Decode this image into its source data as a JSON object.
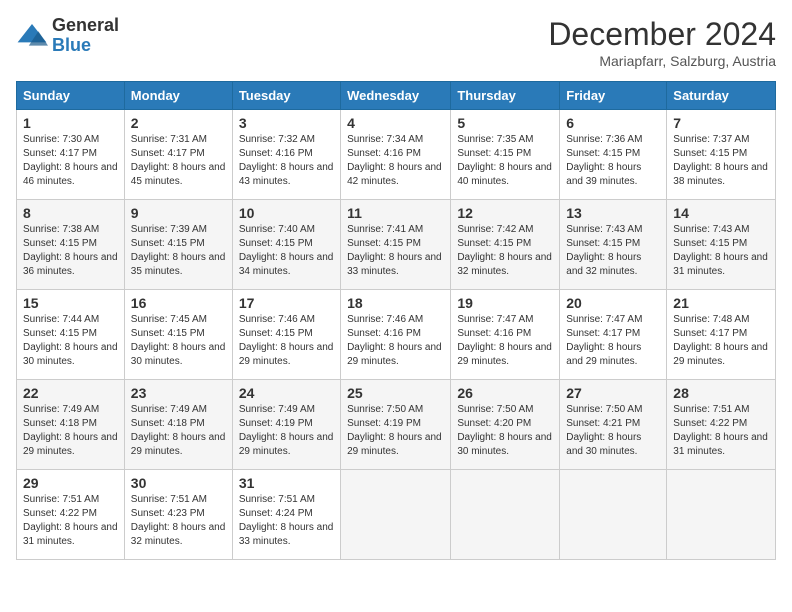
{
  "logo": {
    "general": "General",
    "blue": "Blue"
  },
  "title": {
    "month_year": "December 2024",
    "location": "Mariapfarr, Salzburg, Austria"
  },
  "weekdays": [
    "Sunday",
    "Monday",
    "Tuesday",
    "Wednesday",
    "Thursday",
    "Friday",
    "Saturday"
  ],
  "weeks": [
    [
      {
        "day": "1",
        "sunrise": "7:30 AM",
        "sunset": "4:17 PM",
        "daylight": "8 hours and 46 minutes."
      },
      {
        "day": "2",
        "sunrise": "7:31 AM",
        "sunset": "4:17 PM",
        "daylight": "8 hours and 45 minutes."
      },
      {
        "day": "3",
        "sunrise": "7:32 AM",
        "sunset": "4:16 PM",
        "daylight": "8 hours and 43 minutes."
      },
      {
        "day": "4",
        "sunrise": "7:34 AM",
        "sunset": "4:16 PM",
        "daylight": "8 hours and 42 minutes."
      },
      {
        "day": "5",
        "sunrise": "7:35 AM",
        "sunset": "4:15 PM",
        "daylight": "8 hours and 40 minutes."
      },
      {
        "day": "6",
        "sunrise": "7:36 AM",
        "sunset": "4:15 PM",
        "daylight": "8 hours and 39 minutes."
      },
      {
        "day": "7",
        "sunrise": "7:37 AM",
        "sunset": "4:15 PM",
        "daylight": "8 hours and 38 minutes."
      }
    ],
    [
      {
        "day": "8",
        "sunrise": "7:38 AM",
        "sunset": "4:15 PM",
        "daylight": "8 hours and 36 minutes."
      },
      {
        "day": "9",
        "sunrise": "7:39 AM",
        "sunset": "4:15 PM",
        "daylight": "8 hours and 35 minutes."
      },
      {
        "day": "10",
        "sunrise": "7:40 AM",
        "sunset": "4:15 PM",
        "daylight": "8 hours and 34 minutes."
      },
      {
        "day": "11",
        "sunrise": "7:41 AM",
        "sunset": "4:15 PM",
        "daylight": "8 hours and 33 minutes."
      },
      {
        "day": "12",
        "sunrise": "7:42 AM",
        "sunset": "4:15 PM",
        "daylight": "8 hours and 32 minutes."
      },
      {
        "day": "13",
        "sunrise": "7:43 AM",
        "sunset": "4:15 PM",
        "daylight": "8 hours and 32 minutes."
      },
      {
        "day": "14",
        "sunrise": "7:43 AM",
        "sunset": "4:15 PM",
        "daylight": "8 hours and 31 minutes."
      }
    ],
    [
      {
        "day": "15",
        "sunrise": "7:44 AM",
        "sunset": "4:15 PM",
        "daylight": "8 hours and 30 minutes."
      },
      {
        "day": "16",
        "sunrise": "7:45 AM",
        "sunset": "4:15 PM",
        "daylight": "8 hours and 30 minutes."
      },
      {
        "day": "17",
        "sunrise": "7:46 AM",
        "sunset": "4:15 PM",
        "daylight": "8 hours and 29 minutes."
      },
      {
        "day": "18",
        "sunrise": "7:46 AM",
        "sunset": "4:16 PM",
        "daylight": "8 hours and 29 minutes."
      },
      {
        "day": "19",
        "sunrise": "7:47 AM",
        "sunset": "4:16 PM",
        "daylight": "8 hours and 29 minutes."
      },
      {
        "day": "20",
        "sunrise": "7:47 AM",
        "sunset": "4:17 PM",
        "daylight": "8 hours and 29 minutes."
      },
      {
        "day": "21",
        "sunrise": "7:48 AM",
        "sunset": "4:17 PM",
        "daylight": "8 hours and 29 minutes."
      }
    ],
    [
      {
        "day": "22",
        "sunrise": "7:49 AM",
        "sunset": "4:18 PM",
        "daylight": "8 hours and 29 minutes."
      },
      {
        "day": "23",
        "sunrise": "7:49 AM",
        "sunset": "4:18 PM",
        "daylight": "8 hours and 29 minutes."
      },
      {
        "day": "24",
        "sunrise": "7:49 AM",
        "sunset": "4:19 PM",
        "daylight": "8 hours and 29 minutes."
      },
      {
        "day": "25",
        "sunrise": "7:50 AM",
        "sunset": "4:19 PM",
        "daylight": "8 hours and 29 minutes."
      },
      {
        "day": "26",
        "sunrise": "7:50 AM",
        "sunset": "4:20 PM",
        "daylight": "8 hours and 30 minutes."
      },
      {
        "day": "27",
        "sunrise": "7:50 AM",
        "sunset": "4:21 PM",
        "daylight": "8 hours and 30 minutes."
      },
      {
        "day": "28",
        "sunrise": "7:51 AM",
        "sunset": "4:22 PM",
        "daylight": "8 hours and 31 minutes."
      }
    ],
    [
      {
        "day": "29",
        "sunrise": "7:51 AM",
        "sunset": "4:22 PM",
        "daylight": "8 hours and 31 minutes."
      },
      {
        "day": "30",
        "sunrise": "7:51 AM",
        "sunset": "4:23 PM",
        "daylight": "8 hours and 32 minutes."
      },
      {
        "day": "31",
        "sunrise": "7:51 AM",
        "sunset": "4:24 PM",
        "daylight": "8 hours and 33 minutes."
      },
      null,
      null,
      null,
      null
    ]
  ],
  "labels": {
    "sunrise": "Sunrise:",
    "sunset": "Sunset:",
    "daylight": "Daylight:"
  }
}
